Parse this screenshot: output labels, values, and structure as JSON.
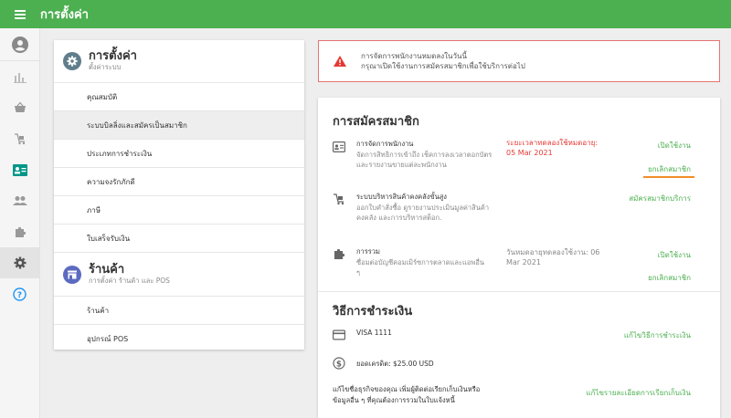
{
  "app": {
    "title": "การตั้งค่า"
  },
  "colors": {
    "brand": "#4caf50",
    "alert_red": "#e53935",
    "link_green": "#4caf50",
    "accent_orange": "#f28c28"
  },
  "sidebar": {
    "items": [
      {
        "icon": "account-circle-icon"
      },
      {
        "icon": "bar-chart-icon"
      },
      {
        "icon": "basket-icon"
      },
      {
        "icon": "cart-icon"
      },
      {
        "icon": "id-card-icon"
      },
      {
        "icon": "people-icon"
      },
      {
        "icon": "puzzle-icon"
      },
      {
        "icon": "gear-icon",
        "active": true
      },
      {
        "icon": "help-icon"
      }
    ]
  },
  "settings_panel": {
    "section1": {
      "title": "การตั้งค่า",
      "subtitle": "ตั้งค่าระบบ",
      "items": [
        "คุณสมบัติ",
        "ระบบบิลลิ่งและสมัครเป็นสมาชิก",
        "ประเภทการชำระเงิน",
        "ความจงรักภักดี",
        "ภาษี",
        "ใบเสร็จรับเงิน"
      ],
      "active_index": 1
    },
    "section2": {
      "title": "ร้านค้า",
      "subtitle": "การตั้งค่า ร้านค้า และ POS",
      "items": [
        "ร้านค้า",
        "อุปกรณ์ POS"
      ]
    }
  },
  "alert": {
    "line1": "การจัดการพนักงานหมดลงในวันนี้",
    "line2": "กรุณาเปิดใช้งานการสมัครสมาชิกเพื่อใช้บริการต่อไป"
  },
  "subscriptions": {
    "heading": "การสมัครสมาชิก",
    "rows": [
      {
        "icon": "badge-icon",
        "title": "การจัดการพนักงาน",
        "desc": "จัดการสิทธิการเข้าถึง เช็คการลงเวลาตอกบัตร และรายงานขายแต่ละพนักงาน",
        "status_line1": "ระยะเวลาทดลองใช้หมดอายุ:",
        "status_line2": "05 Mar 2021",
        "links": [
          "เปิดใช้งาน",
          "ยกเลิกสมาชิก"
        ]
      },
      {
        "icon": "inventory-cart-icon",
        "title": "ระบบบริหารสินค้าคงคลังขั้นสูง",
        "desc": "ออกใบคำสั่งซื้อ ดูรายงานประเมินมูลค่าสินค้าคงคลัง และการบริหารสต็อก.",
        "links": [
          "สมัครสมาชิกบริการ"
        ]
      },
      {
        "icon": "puzzle-icon",
        "title": "การรวม",
        "desc": "ซื่อมต่อบัญชีคอมเมิร์ซการตลาดและแอพอื่น ๆ",
        "status_line1": "วันหมดอายุทดลองใช้งาน: 06",
        "status_line2": "Mar 2021",
        "links": [
          "เปิดใช้งาน",
          "ยกเลิกสมาชิก"
        ]
      }
    ]
  },
  "payment": {
    "heading": "วิธีการชำระเงิน",
    "card_label": "VISA 1111",
    "card_link": "แก้ไขวิธีการชำระเงิน",
    "credit_label": "ยอดเครดิต: $25.00 USD",
    "billing_text_line1": "แก้ไขชื่อธุรกิจของคุณ เพิ่มผู้ติดต่อเรียกเก็บเงินหรือ",
    "billing_text_line2": "ข้อมูลอื่น ๆ ที่คุณต้องการรวมในใบแจ้งหนี้",
    "billing_link": "แก้ไขรายละเอียดการเรียกเก็บเงิน"
  }
}
